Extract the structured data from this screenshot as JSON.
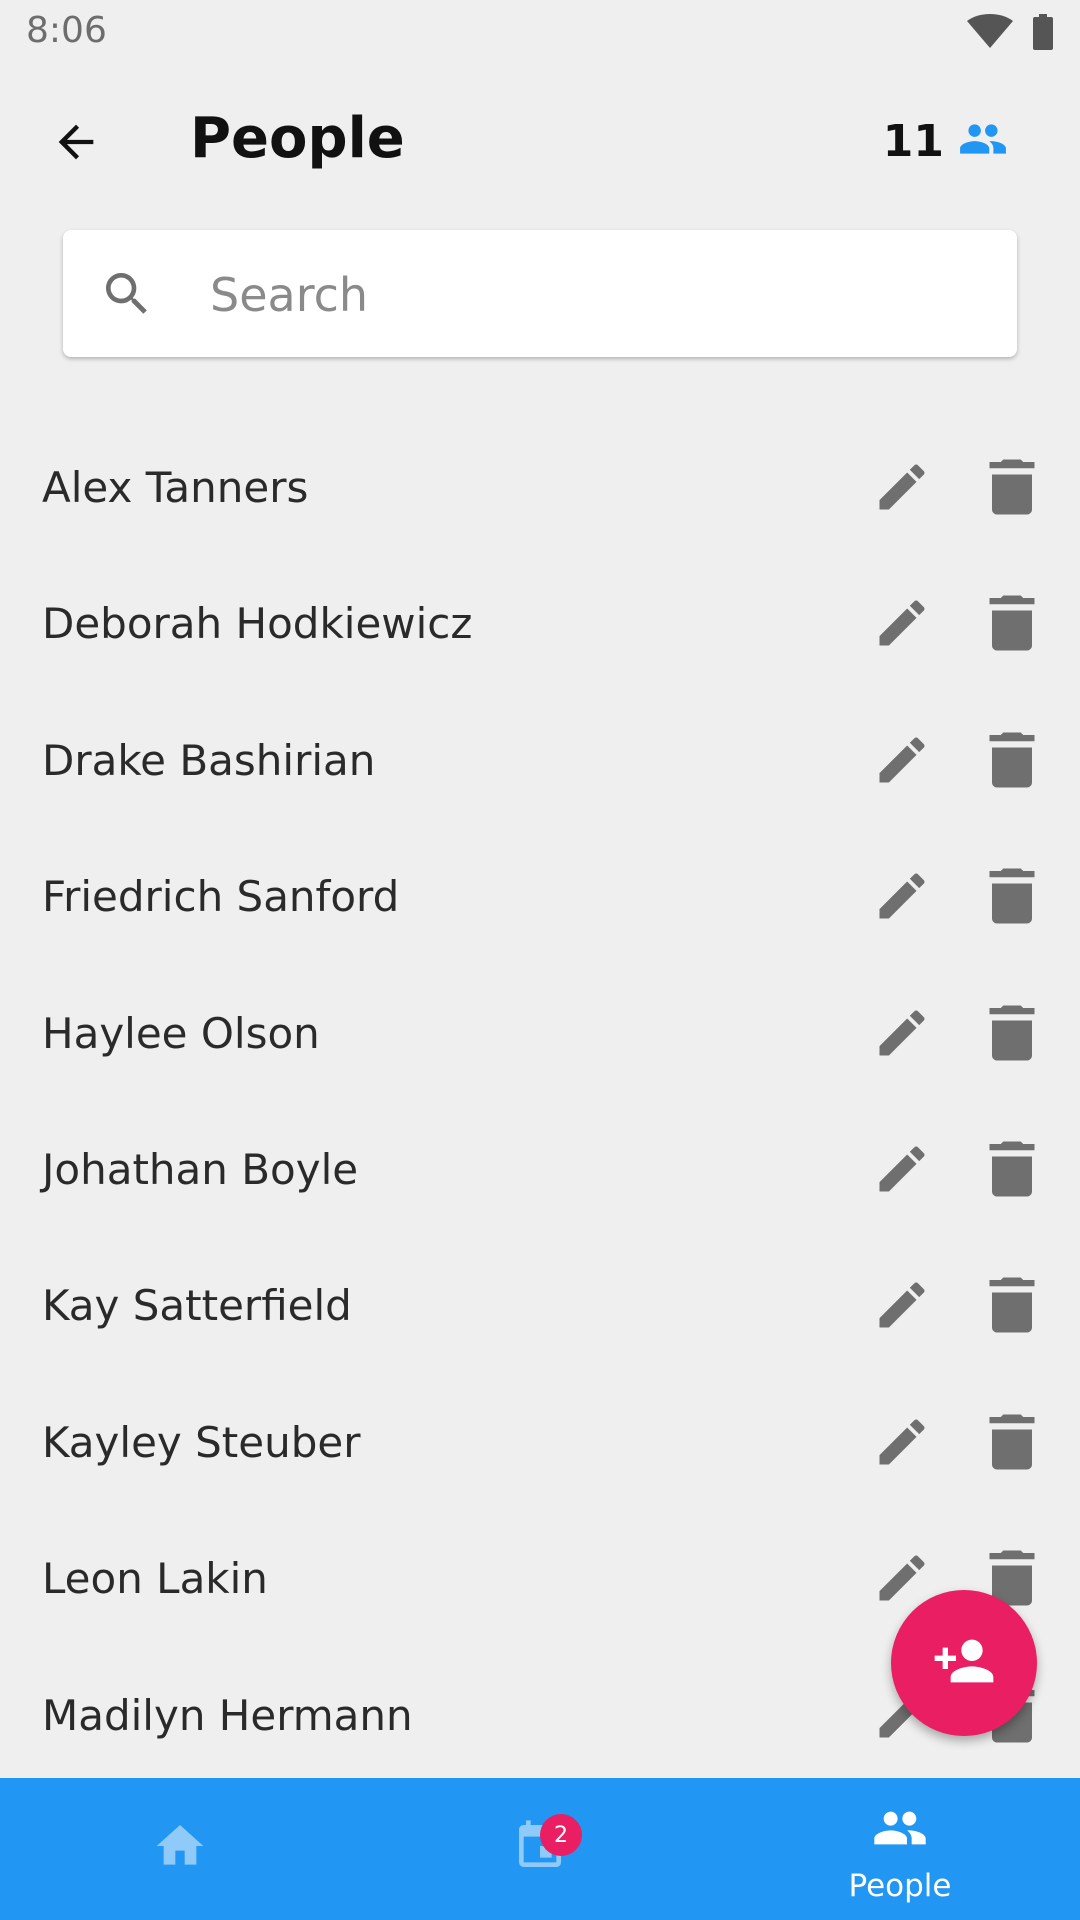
{
  "status_bar": {
    "time": "8:06"
  },
  "header": {
    "title": "People",
    "count": "11",
    "back_icon": "arrow-back-icon",
    "count_icon": "people-icon",
    "count_icon_color": "#2196f3"
  },
  "search": {
    "placeholder": "Search",
    "value": ""
  },
  "people": [
    {
      "name": "Alex Tanners"
    },
    {
      "name": "Deborah Hodkiewicz"
    },
    {
      "name": "Drake Bashirian"
    },
    {
      "name": "Friedrich Sanford"
    },
    {
      "name": "Haylee Olson"
    },
    {
      "name": "Johathan Boyle"
    },
    {
      "name": "Kay Satterfield"
    },
    {
      "name": "Kayley Steuber"
    },
    {
      "name": "Leon Lakin"
    },
    {
      "name": "Madilyn Hermann"
    }
  ],
  "fab": {
    "icon": "person-add-icon",
    "color": "#e91e63"
  },
  "bottom_nav": {
    "background": "#2196f3",
    "items": [
      {
        "icon": "home-icon",
        "label": "",
        "active": false
      },
      {
        "icon": "calendar-icon",
        "label": "",
        "badge": "2",
        "active": false
      },
      {
        "icon": "people-icon",
        "label": "People",
        "active": true
      }
    ]
  },
  "colors": {
    "background": "#efefef",
    "icon_gray": "#6f6f6f",
    "accent_blue": "#2196f3",
    "accent_pink": "#e91e63"
  }
}
